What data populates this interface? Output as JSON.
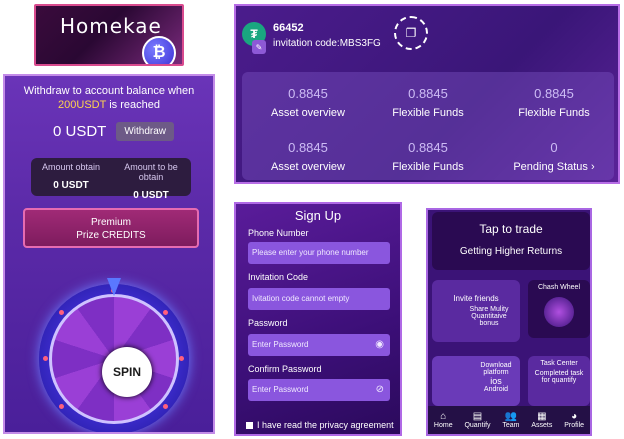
{
  "logo": {
    "brand": "Homekae",
    "coin_glyph": "₿"
  },
  "spin": {
    "withdraw_line1": "Withdraw to account balance when",
    "withdraw_amount": "200USDT",
    "withdraw_line2": "is reached",
    "balance": "0 USDT",
    "withdraw_label": "Withdraw",
    "amount_obtain_label": "Amount obtain",
    "amount_obtain_value": "0 USDT",
    "amount_to_obtain_label": "Amount to be obtain",
    "amount_to_obtain_value": "0 USDT",
    "premium_line1": "Premium",
    "premium_line2": "Prize CREDITS",
    "spin_label": "SPIN"
  },
  "account": {
    "uid": "66452",
    "invitation": "invitation code:MBS3FG",
    "stats": [
      {
        "value": "0.8845",
        "label": "Asset overview"
      },
      {
        "value": "0.8845",
        "label": "Flexible Funds"
      },
      {
        "value": "0.8845",
        "label": "Flexible Funds"
      },
      {
        "value": "0.8845",
        "label": "Asset overview"
      },
      {
        "value": "0.8845",
        "label": "Flexible Funds"
      },
      {
        "value": "0",
        "label": "Pending Status"
      }
    ],
    "chevron": "›"
  },
  "signup": {
    "title": "Sign Up",
    "phone_label": "Phone Number",
    "phone_placeholder": "Please enter your phone number",
    "invite_label": "Invitation Code",
    "invite_placeholder": "Ivitation code cannot empty",
    "password_label": "Password",
    "password_placeholder": "Enter Password",
    "confirm_label": "Confirm Password",
    "confirm_placeholder": "Enter Password",
    "agree_text": "I have read the privacy agreement"
  },
  "home": {
    "tap_title": "Tap to trade",
    "tap_subtitle": "Getting Higher Returns",
    "invite_title": "Invite friends",
    "invite_sub": "Share Mulity Quantitaive bonus",
    "cash_wheel": "Chash Wheel",
    "download_title": "Download platform",
    "download_ios": "ios",
    "download_android": "Android",
    "task_title": "Task Center",
    "task_sub": "Completed task for quantify",
    "tabs": [
      {
        "icon": "⌂",
        "label": "Home"
      },
      {
        "icon": "▤",
        "label": "Quantify"
      },
      {
        "icon": "👥",
        "label": "Team"
      },
      {
        "icon": "▦",
        "label": "Assets"
      },
      {
        "icon": "◕",
        "label": "Profile"
      }
    ]
  }
}
